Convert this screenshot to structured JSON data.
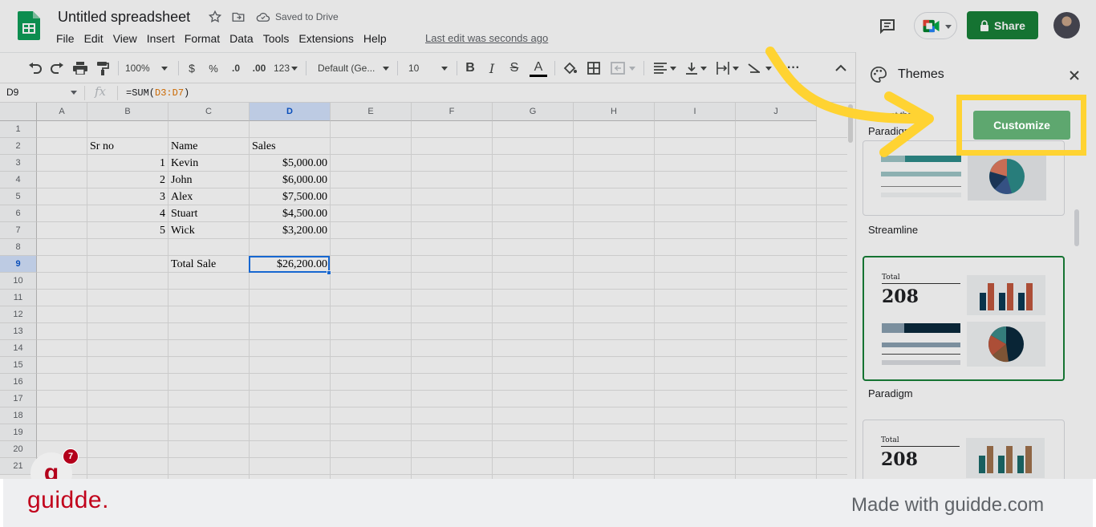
{
  "app": {
    "title": "Untitled spreadsheet",
    "save_status": "Saved to Drive",
    "last_edit": "Last edit was seconds ago",
    "share_label": "Share",
    "menu": [
      "File",
      "Edit",
      "View",
      "Insert",
      "Format",
      "Data",
      "Tools",
      "Extensions",
      "Help"
    ]
  },
  "toolbar": {
    "zoom": "100%",
    "currency": "$",
    "percent": "%",
    "dec_decrease": ".0",
    "dec_increase": ".00",
    "more_formats": "123",
    "font": "Default (Ge...",
    "font_size": "10",
    "bold": "B",
    "italic": "I",
    "strike": "S",
    "text_color": "A"
  },
  "formula_bar": {
    "name_box": "D9",
    "fx": "fx",
    "formula_prefix": "=SUM(",
    "formula_ref": "D3:D7",
    "formula_suffix": ")"
  },
  "grid": {
    "columns": [
      "A",
      "B",
      "C",
      "D",
      "E",
      "F",
      "G",
      "H",
      "I",
      "J"
    ],
    "rows": [
      "1",
      "2",
      "3",
      "4",
      "5",
      "6",
      "7",
      "8",
      "9",
      "10",
      "11",
      "12",
      "13",
      "14",
      "15",
      "16",
      "17",
      "18",
      "19",
      "20",
      "21"
    ],
    "headers": {
      "sr": "Sr no",
      "name": "Name",
      "sales": "Sales"
    },
    "data_rows": [
      {
        "sr": "1",
        "name": "Kevin",
        "sales": "$5,000.00"
      },
      {
        "sr": "2",
        "name": "John",
        "sales": "$6,000.00"
      },
      {
        "sr": "3",
        "name": "Alex",
        "sales": "$7,500.00"
      },
      {
        "sr": "4",
        "name": "Stuart",
        "sales": "$4,500.00"
      },
      {
        "sr": "5",
        "name": "Wick",
        "sales": "$3,200.00"
      }
    ],
    "total_label": "Total Sale",
    "total_value": "$26,200.00"
  },
  "themes_panel": {
    "title": "Themes",
    "current_label": "Current theme",
    "current_name": "Paradigm",
    "customize_label": "Customize",
    "themes": [
      {
        "name": "Streamline"
      },
      {
        "name": "Paradigm",
        "preview_label": "Total",
        "preview_value": "208"
      },
      {
        "preview_label": "Total",
        "preview_value": "208"
      }
    ]
  },
  "overlay": {
    "badge_letter": "g",
    "badge_count": "7",
    "footer_logo": "guidde.",
    "footer_tagline": "Made with guidde.com",
    "highlight_color": "#ffd332"
  },
  "colors": {
    "share_green": "#188038",
    "customize_green": "#5ea76f",
    "selection_blue": "#1a73e8",
    "guidde_red": "#c1001b"
  }
}
